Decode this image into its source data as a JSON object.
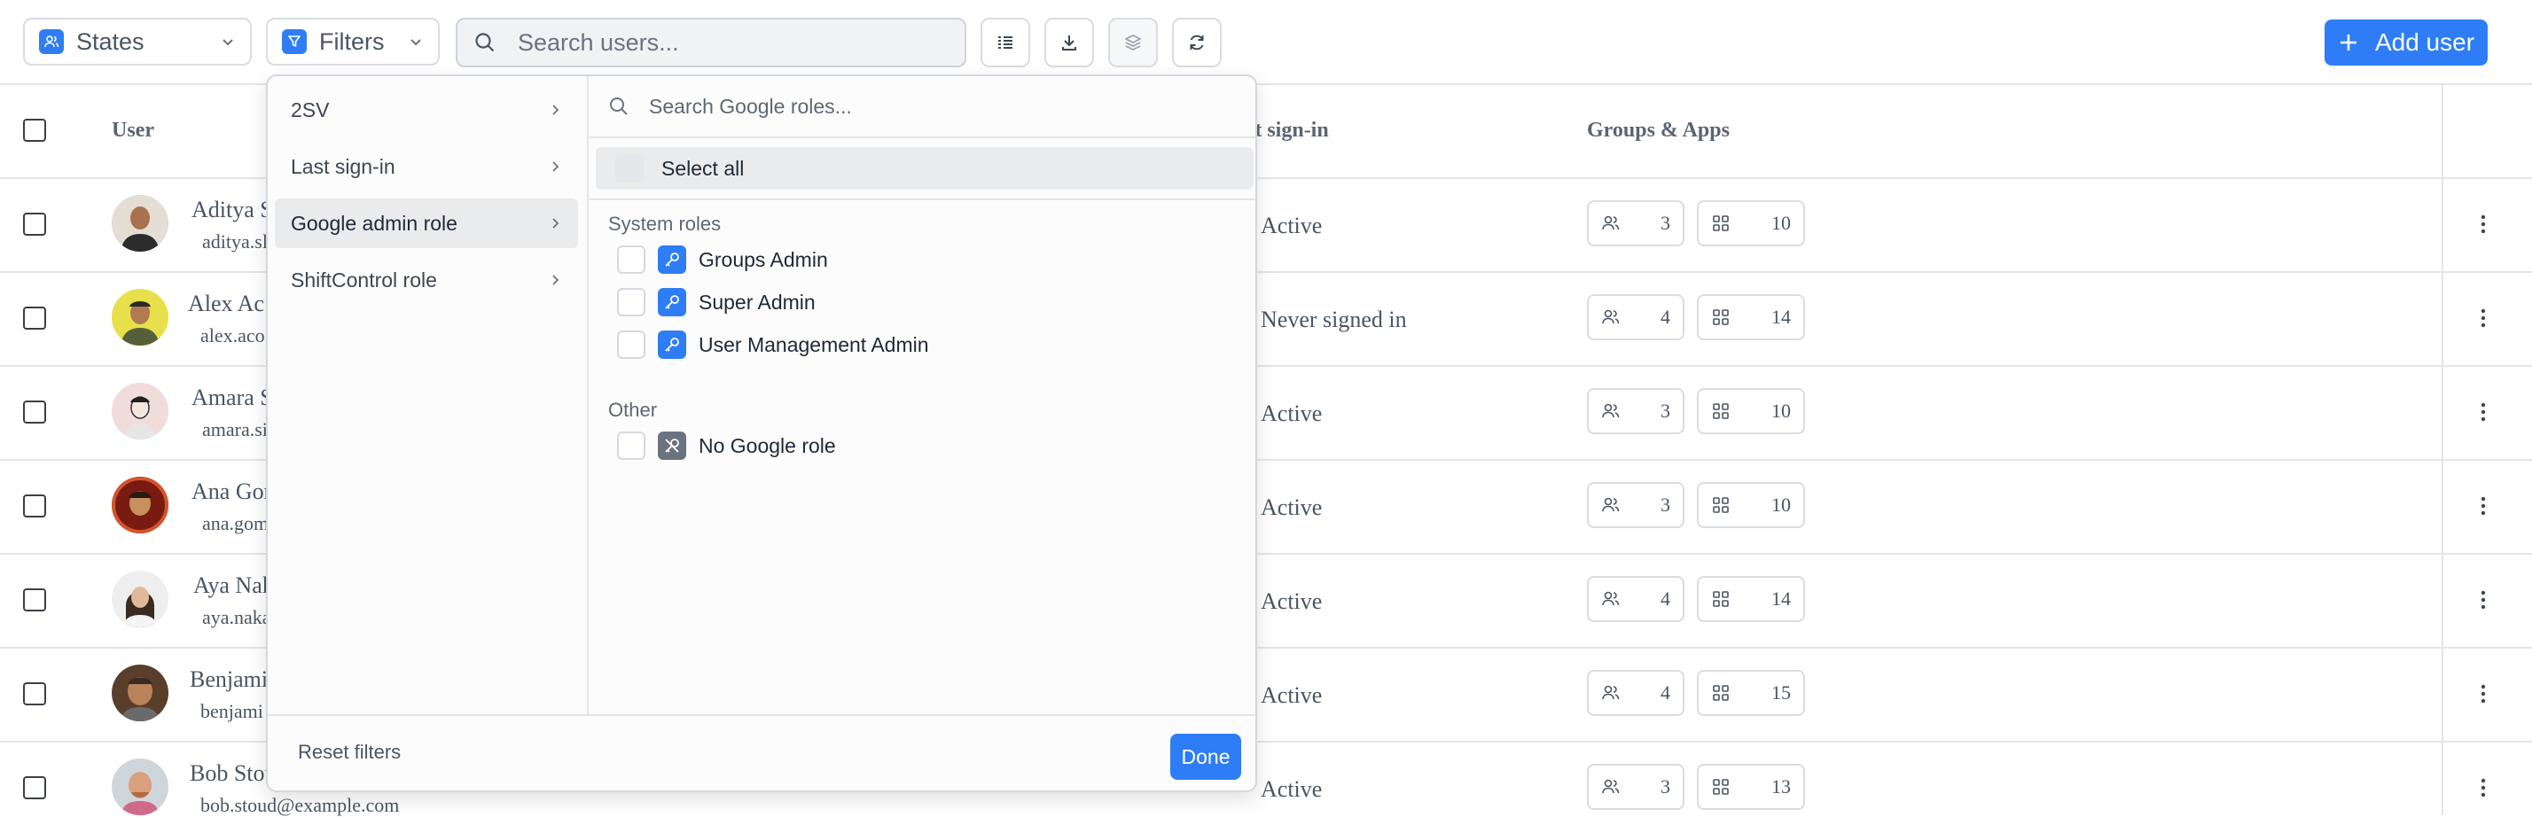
{
  "toolbar": {
    "states_label": "States",
    "filters_label": "Filters",
    "search_placeholder": "Search users...",
    "add_user_label": "Add user"
  },
  "table": {
    "headers": {
      "user": "User",
      "last_signin": "st sign-in",
      "groups_apps": "Groups & Apps"
    },
    "rows": [
      {
        "name": "Aditya S",
        "email": "aditya.sl",
        "last_signin": "Active",
        "groups": "3",
        "apps": "10"
      },
      {
        "name": "Alex Ac",
        "email": "alex.aco",
        "last_signin": "Never signed in",
        "groups": "4",
        "apps": "14"
      },
      {
        "name": "Amara S",
        "email": "amara.si",
        "last_signin": "Active",
        "groups": "3",
        "apps": "10"
      },
      {
        "name": "Ana Gon",
        "email": "ana.gom",
        "last_signin": "Active",
        "groups": "3",
        "apps": "10"
      },
      {
        "name": "Aya Nak",
        "email": "aya.naka",
        "last_signin": "Active",
        "groups": "4",
        "apps": "14"
      },
      {
        "name": "Benjami",
        "email": "benjami",
        "last_signin": "Active",
        "groups": "4",
        "apps": "15"
      },
      {
        "name": "Bob Stou",
        "email": "bob.stoud@example.com",
        "last_signin": "Active",
        "groups": "3",
        "apps": "13"
      }
    ]
  },
  "filter_menu": {
    "categories": [
      {
        "label": "2SV"
      },
      {
        "label": "Last sign-in"
      },
      {
        "label": "Google admin role"
      },
      {
        "label": "ShiftControl role"
      }
    ],
    "role_search_placeholder": "Search Google roles...",
    "select_all_label": "Select all",
    "groups": [
      {
        "title": "System roles",
        "items": [
          "Groups Admin",
          "Super Admin",
          "User Management Admin"
        ]
      },
      {
        "title": "Other",
        "items": [
          "No Google role"
        ]
      }
    ],
    "reset_label": "Reset filters",
    "done_label": "Done"
  },
  "colors": {
    "accent": "#2f7df6",
    "border": "#d9dce1",
    "text": "#4b5563"
  }
}
